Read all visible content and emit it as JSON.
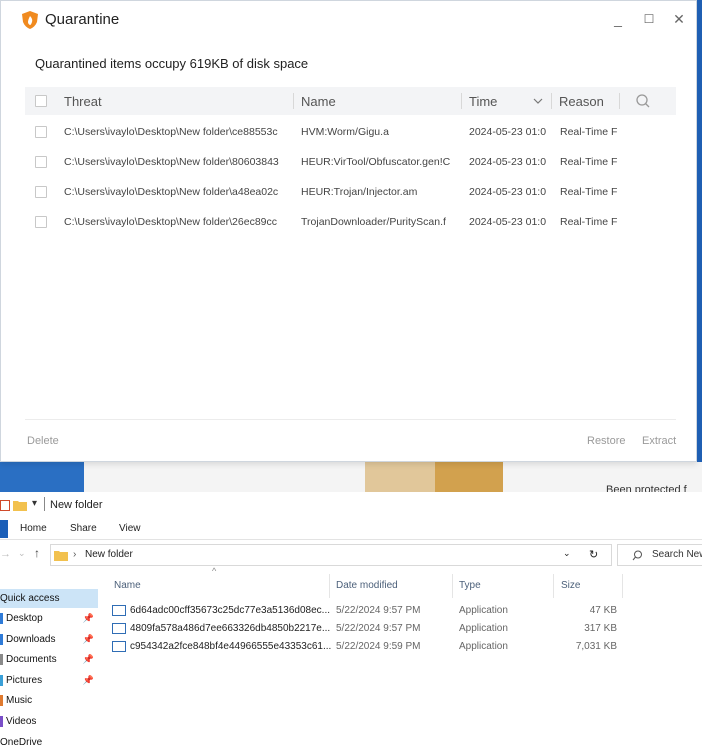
{
  "quarantine": {
    "title": "Quarantine",
    "window_controls": {
      "minimize": "_",
      "maximize": "☐",
      "close": "✕"
    },
    "summary": "Quarantined items occupy 619KB of disk space",
    "columns": {
      "threat": "Threat",
      "name": "Name",
      "time": "Time",
      "reason": "Reason"
    },
    "rows": [
      {
        "threat": "C:\\Users\\ivaylo\\Desktop\\New folder\\ce88553c",
        "name": "HVM:Worm/Gigu.a",
        "time": "2024-05-23 01:0",
        "reason": "Real-Time F"
      },
      {
        "threat": "C:\\Users\\ivaylo\\Desktop\\New folder\\80603843",
        "name": "HEUR:VirTool/Obfuscator.gen!C",
        "time": "2024-05-23 01:0",
        "reason": "Real-Time F"
      },
      {
        "threat": "C:\\Users\\ivaylo\\Desktop\\New folder\\a48ea02c",
        "name": "HEUR:Trojan/Injector.am",
        "time": "2024-05-23 01:0",
        "reason": "Real-Time F"
      },
      {
        "threat": "C:\\Users\\ivaylo\\Desktop\\New folder\\26ec89cc",
        "name": "TrojanDownloader/PurityScan.f",
        "time": "2024-05-23 01:0",
        "reason": "Real-Time F"
      }
    ],
    "footer": {
      "delete": "Delete",
      "restore": "Restore",
      "extract": "Extract"
    }
  },
  "background": {
    "partial_text": "Been protected f"
  },
  "explorer": {
    "title": "New folder",
    "ribbon_tabs": [
      "Home",
      "Share",
      "View"
    ],
    "address": {
      "path": "New folder",
      "search_placeholder": "Search New"
    },
    "nav": {
      "quick_access": "Quick access",
      "items": [
        "Desktop",
        "Downloads",
        "Documents",
        "Pictures",
        "Music",
        "Videos"
      ],
      "onedrive": "OneDrive"
    },
    "columns": {
      "name": "Name",
      "date": "Date modified",
      "type": "Type",
      "size": "Size"
    },
    "files": [
      {
        "name": "6d64adc00cff35673c25dc77e3a5136d08ec...",
        "date": "5/22/2024 9:57 PM",
        "type": "Application",
        "size": "47 KB"
      },
      {
        "name": "4809fa578a486d7ee663326db4850b2217e...",
        "date": "5/22/2024 9:57 PM",
        "type": "Application",
        "size": "317 KB"
      },
      {
        "name": "c954342a2fce848bf4e44966555e43353c61...",
        "date": "5/22/2024 9:59 PM",
        "type": "Application",
        "size": "7,031 KB"
      }
    ]
  }
}
